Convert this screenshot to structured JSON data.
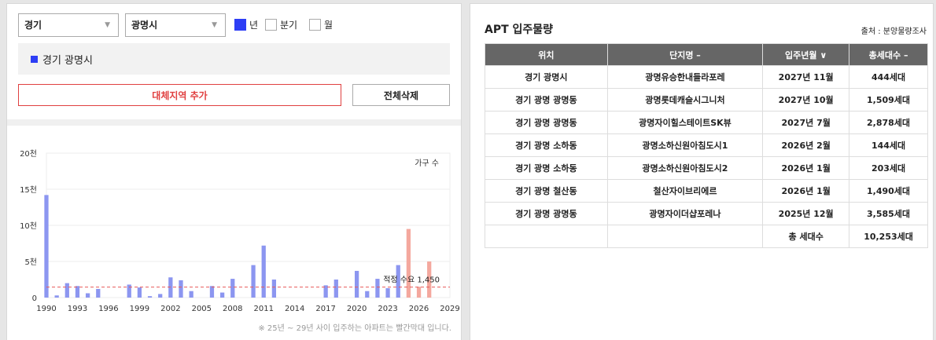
{
  "filters": {
    "province": "경기",
    "city": "광명시",
    "periods": [
      {
        "label": "년",
        "checked": true
      },
      {
        "label": "분기",
        "checked": false
      },
      {
        "label": "월",
        "checked": false
      }
    ]
  },
  "region_list": {
    "item": "경기 광명시"
  },
  "buttons": {
    "add_region": "대체지역 추가",
    "delete_all": "전체삭제"
  },
  "chart_note": "※ 25년 ~ 29년 사이 입주하는 아파트는 빨간막대 입니다.",
  "colors": {
    "past": "#8c96f0",
    "future": "#f4a89e",
    "accent": "#2d3ef5",
    "threshold": "#e85a5a"
  },
  "chart_data": {
    "type": "bar",
    "legend": "가구 수",
    "x": [
      1990,
      1991,
      1992,
      1993,
      1994,
      1995,
      1996,
      1997,
      1998,
      1999,
      2000,
      2001,
      2002,
      2003,
      2004,
      2005,
      2006,
      2007,
      2008,
      2009,
      2010,
      2011,
      2012,
      2013,
      2014,
      2015,
      2016,
      2017,
      2018,
      2019,
      2020,
      2021,
      2022,
      2023,
      2024,
      2025,
      2026,
      2027,
      2028
    ],
    "values": [
      14200,
      300,
      2000,
      1600,
      600,
      1200,
      0,
      0,
      1800,
      1400,
      200,
      500,
      2800,
      2400,
      900,
      0,
      1600,
      700,
      2600,
      0,
      4500,
      7200,
      2500,
      0,
      0,
      0,
      0,
      1700,
      2500,
      0,
      3700,
      900,
      2600,
      1300,
      4500,
      9500,
      1500,
      5000,
      0
    ],
    "future_from": 2025,
    "xticks": [
      1990,
      1993,
      1996,
      1999,
      2002,
      2005,
      2008,
      2011,
      2014,
      2017,
      2020,
      2023,
      2026,
      2029
    ],
    "yticks": [
      "0",
      "5천",
      "10천",
      "15천",
      "20천"
    ],
    "ylim": [
      0,
      20000
    ],
    "xlim": [
      1990,
      2029
    ],
    "threshold": {
      "value": 1450,
      "label": "적정 수요 1,450"
    }
  },
  "right_panel": {
    "title": "APT 입주물량",
    "source": "출처 : 분양물량조사",
    "columns": [
      "위치",
      "단지명 –",
      "입주년월 ∨",
      "총세대수 –"
    ],
    "rows": [
      [
        "경기 광명시",
        "광명유승한내들라포레",
        "2027년 11월",
        "444세대"
      ],
      [
        "경기 광명 광명동",
        "광명롯데캐슬시그니처",
        "2027년 10월",
        "1,509세대"
      ],
      [
        "경기 광명 광명동",
        "광명자이힐스테이트SK뷰",
        "2027년 7월",
        "2,878세대"
      ],
      [
        "경기 광명 소하동",
        "광명소하신원아침도시1",
        "2026년 2월",
        "144세대"
      ],
      [
        "경기 광명 소하동",
        "광명소하신원아침도시2",
        "2026년 1월",
        "203세대"
      ],
      [
        "경기 광명 철산동",
        "철산자이브리에르",
        "2026년 1월",
        "1,490세대"
      ],
      [
        "경기 광명 광명동",
        "광명자이더샵포레나",
        "2025년 12월",
        "3,585세대"
      ]
    ],
    "total_label": "총 세대수",
    "total_value": "10,253세대"
  }
}
